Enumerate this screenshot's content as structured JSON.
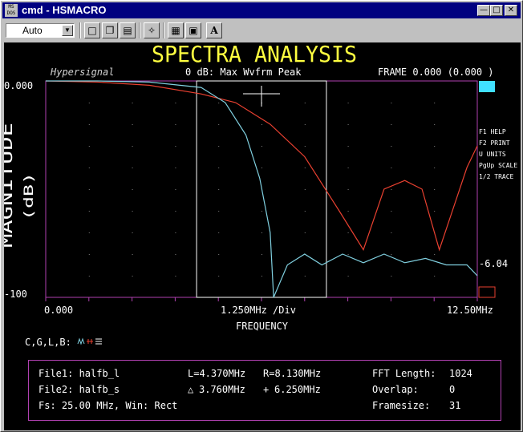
{
  "window": {
    "title": "cmd - HSMACRO",
    "icon_text": "MS DOS"
  },
  "toolbar": {
    "mode_select": "Auto",
    "a_button": "A"
  },
  "screen": {
    "heading": "SPECTRA ANALYSIS",
    "brand": "Hypersignal",
    "ref_label": "0 dB: Max Wvfrm Peak",
    "frame_label": "FRAME 0.000 (0.000 )",
    "y_top": "0.000",
    "y_bottom": "-100",
    "y_axis_title": "MAGNITUDE",
    "y_axis_unit": "(dB)",
    "x_left": "0.000",
    "x_div": "1.250MHz /Div",
    "x_right": "12.50MHz",
    "x_title": "FREQUENCY",
    "marker_value": "-6.04",
    "cglb_label": "C,G,L,B:",
    "help_items": [
      "F1 HELP",
      "F2 PRINT",
      "U UNITS",
      "PgUp SCALE",
      "1/2 TRACE"
    ],
    "colors": {
      "trace1": "#e84030",
      "trace2": "#80d0e0",
      "axis": "#b040b0",
      "text": "#ffffff",
      "heading": "#ffff40",
      "marker": "#40e0ff"
    }
  },
  "info": {
    "file1": "File1: halfb_l",
    "file2": "File2: halfb_s",
    "fs": "Fs: 25.00 MHz, Win: Rect",
    "cursor_l": "L=4.370MHz",
    "cursor_r": "R=8.130MHz",
    "delta_symbol": "△",
    "delta": "3.760MHz",
    "plus_symbol": "+",
    "center": "6.250MHz",
    "fft_label": "FFT Length:",
    "fft_val": "1024",
    "overlap_label": "Overlap:",
    "overlap_val": "0",
    "framesize_label": "Framesize:",
    "framesize_val": "31"
  },
  "chart_data": {
    "type": "line",
    "x_range": [
      0,
      12.5
    ],
    "y_range": [
      -100,
      0
    ],
    "xlabel": "FREQUENCY",
    "ylabel": "MAGNITUDE (dB)",
    "cursors": {
      "L": 4.37,
      "R": 8.13
    },
    "series": [
      {
        "color": "#e84030",
        "x": [
          0,
          1.5,
          3.0,
          4.5,
          5.5,
          6.5,
          7.5,
          8.5,
          9.2,
          9.8,
          10.4,
          10.9,
          11.4,
          12.2,
          12.5
        ],
        "y": [
          0,
          -0.5,
          -2,
          -6,
          -10,
          -20,
          -35,
          -60,
          -78,
          -50,
          -46,
          -50,
          -78,
          -40,
          -30
        ]
      },
      {
        "color": "#80d0e0",
        "x": [
          0,
          1.5,
          3.0,
          4.5,
          5.2,
          5.8,
          6.2,
          6.5,
          6.6,
          7.0,
          7.5,
          8.0,
          8.6,
          9.2,
          9.8,
          10.4,
          11.0,
          11.6,
          12.2,
          12.5
        ],
        "y": [
          0,
          0,
          -0.5,
          -3,
          -10,
          -25,
          -45,
          -70,
          -100,
          -85,
          -80,
          -85,
          -80,
          -84,
          -80,
          -84,
          -82,
          -85,
          -85,
          -90
        ]
      }
    ]
  }
}
